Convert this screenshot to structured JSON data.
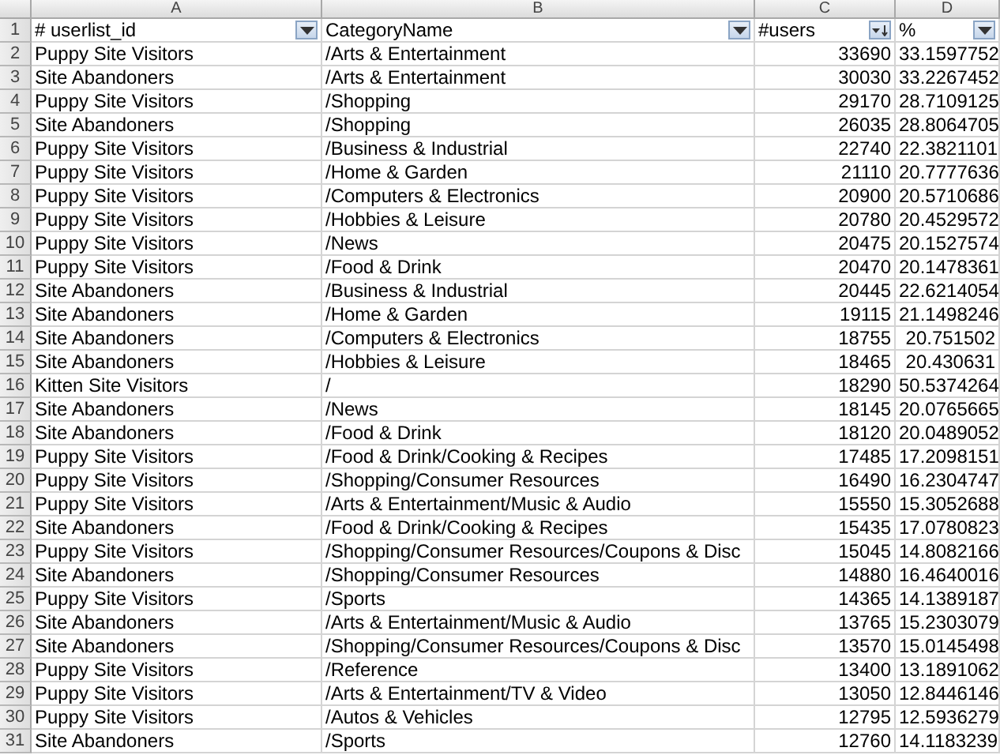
{
  "column_headers": [
    "A",
    "B",
    "C",
    "D"
  ],
  "header_row": {
    "number": "1",
    "cells": [
      {
        "text": "# userlist_id",
        "sorted": false
      },
      {
        "text": "CategoryName",
        "sorted": false
      },
      {
        "text": "#users",
        "sorted": true
      },
      {
        "text": "%",
        "sorted": false
      }
    ]
  },
  "rows": [
    {
      "number": "2",
      "userlist_id": "Puppy Site Visitors",
      "category": "/Arts & Entertainment",
      "users": "33690",
      "percent": "33.1597752"
    },
    {
      "number": "3",
      "userlist_id": "Site Abandoners",
      "category": "/Arts & Entertainment",
      "users": "30030",
      "percent": "33.2267452"
    },
    {
      "number": "4",
      "userlist_id": "Puppy Site Visitors",
      "category": "/Shopping",
      "users": "29170",
      "percent": "28.7109125"
    },
    {
      "number": "5",
      "userlist_id": "Site Abandoners",
      "category": "/Shopping",
      "users": "26035",
      "percent": "28.8064705"
    },
    {
      "number": "6",
      "userlist_id": "Puppy Site Visitors",
      "category": "/Business & Industrial",
      "users": "22740",
      "percent": "22.3821101"
    },
    {
      "number": "7",
      "userlist_id": "Puppy Site Visitors",
      "category": "/Home & Garden",
      "users": "21110",
      "percent": "20.7777636"
    },
    {
      "number": "8",
      "userlist_id": "Puppy Site Visitors",
      "category": "/Computers & Electronics",
      "users": "20900",
      "percent": "20.5710686"
    },
    {
      "number": "9",
      "userlist_id": "Puppy Site Visitors",
      "category": "/Hobbies & Leisure",
      "users": "20780",
      "percent": "20.4529572"
    },
    {
      "number": "10",
      "userlist_id": "Puppy Site Visitors",
      "category": "/News",
      "users": "20475",
      "percent": "20.1527574"
    },
    {
      "number": "11",
      "userlist_id": "Puppy Site Visitors",
      "category": "/Food & Drink",
      "users": "20470",
      "percent": "20.1478361"
    },
    {
      "number": "12",
      "userlist_id": "Site Abandoners",
      "category": "/Business & Industrial",
      "users": "20445",
      "percent": "22.6214054"
    },
    {
      "number": "13",
      "userlist_id": "Site Abandoners",
      "category": "/Home & Garden",
      "users": "19115",
      "percent": "21.1498246"
    },
    {
      "number": "14",
      "userlist_id": "Site Abandoners",
      "category": "/Computers & Electronics",
      "users": "18755",
      "percent": "20.751502"
    },
    {
      "number": "15",
      "userlist_id": "Site Abandoners",
      "category": "/Hobbies & Leisure",
      "users": "18465",
      "percent": "20.430631"
    },
    {
      "number": "16",
      "userlist_id": "Kitten Site Visitors",
      "category": "/",
      "users": "18290",
      "percent": "50.5374264"
    },
    {
      "number": "17",
      "userlist_id": "Site Abandoners",
      "category": "/News",
      "users": "18145",
      "percent": "20.0765665"
    },
    {
      "number": "18",
      "userlist_id": "Site Abandoners",
      "category": "/Food & Drink",
      "users": "18120",
      "percent": "20.0489052"
    },
    {
      "number": "19",
      "userlist_id": "Puppy Site Visitors",
      "category": "/Food & Drink/Cooking & Recipes",
      "users": "17485",
      "percent": "17.2098151"
    },
    {
      "number": "20",
      "userlist_id": "Puppy Site Visitors",
      "category": "/Shopping/Consumer Resources",
      "users": "16490",
      "percent": "16.2304747"
    },
    {
      "number": "21",
      "userlist_id": "Puppy Site Visitors",
      "category": "/Arts & Entertainment/Music & Audio",
      "users": "15550",
      "percent": "15.3052688"
    },
    {
      "number": "22",
      "userlist_id": "Site Abandoners",
      "category": "/Food & Drink/Cooking & Recipes",
      "users": "15435",
      "percent": "17.0780823"
    },
    {
      "number": "23",
      "userlist_id": "Puppy Site Visitors",
      "category": "/Shopping/Consumer Resources/Coupons & Disc",
      "users": "15045",
      "percent": "14.8082166"
    },
    {
      "number": "24",
      "userlist_id": "Site Abandoners",
      "category": "/Shopping/Consumer Resources",
      "users": "14880",
      "percent": "16.4640016"
    },
    {
      "number": "25",
      "userlist_id": "Puppy Site Visitors",
      "category": "/Sports",
      "users": "14365",
      "percent": "14.1389187"
    },
    {
      "number": "26",
      "userlist_id": "Site Abandoners",
      "category": "/Arts & Entertainment/Music & Audio",
      "users": "13765",
      "percent": "15.2303079"
    },
    {
      "number": "27",
      "userlist_id": "Site Abandoners",
      "category": "/Shopping/Consumer Resources/Coupons & Disc",
      "users": "13570",
      "percent": "15.0145498"
    },
    {
      "number": "28",
      "userlist_id": "Puppy Site Visitors",
      "category": "/Reference",
      "users": "13400",
      "percent": "13.1891062"
    },
    {
      "number": "29",
      "userlist_id": "Puppy Site Visitors",
      "category": "/Arts & Entertainment/TV & Video",
      "users": "13050",
      "percent": "12.8446146"
    },
    {
      "number": "30",
      "userlist_id": "Puppy Site Visitors",
      "category": "/Autos & Vehicles",
      "users": "12795",
      "percent": "12.5936279"
    },
    {
      "number": "31",
      "userlist_id": "Site Abandoners",
      "category": "/Sports",
      "users": "12760",
      "percent": "14.1183239"
    }
  ]
}
